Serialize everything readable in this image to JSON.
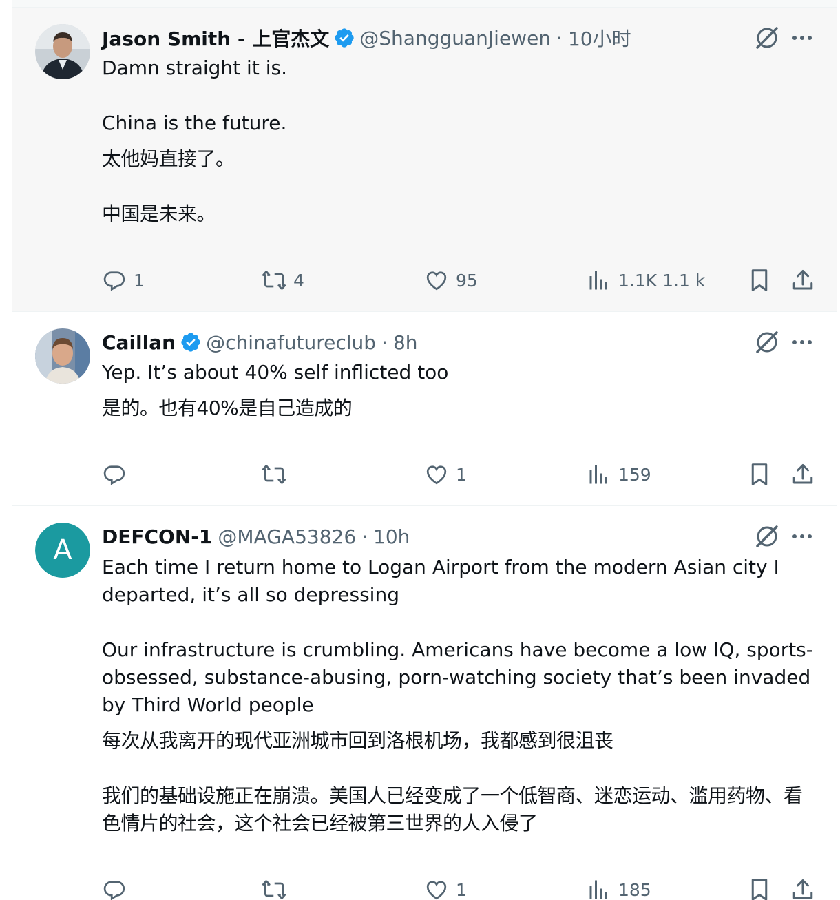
{
  "tweets": [
    {
      "name": "Jason Smith - 上官杰文",
      "handle": "@ShangguanJiewen",
      "separator": "·",
      "time": "10小时",
      "text_en": [
        "Damn straight it is.",
        "",
        "China is the future."
      ],
      "text_zh": [
        "太他妈直接了。",
        "",
        "中国是未来。"
      ],
      "replies": "1",
      "retweets": "4",
      "likes": "95",
      "views": "1.1K 1.1 k"
    },
    {
      "name": "Caillan",
      "handle": "@chinafutureclub",
      "separator": "·",
      "time": "8h",
      "text_en": [
        "Yep. It’s about 40% self inflicted too"
      ],
      "text_zh": [
        "是的。也有40%是自己造成的"
      ],
      "replies": "",
      "retweets": "",
      "likes": "1",
      "views": "159"
    },
    {
      "name": "DEFCON-1",
      "avatar_letter": "A",
      "handle": "@MAGA53826",
      "separator": "·",
      "time": "10h",
      "text_en": [
        "Each time I return home to Logan Airport from the modern Asian city I departed, it’s all so depressing",
        "",
        "Our infrastructure is crumbling. Americans have become a low IQ, sports-obsessed, substance-abusing, porn-watching society that’s been invaded by Third World people"
      ],
      "text_zh": [
        "每次从我离开的现代亚洲城市回到洛根机场，我都感到很沮丧",
        "",
        "我们的基础设施正在崩溃。美国人已经变成了一个低智商、迷恋运动、滥用药物、看色情片的社会，这个社会已经被第三世界的人入侵了"
      ],
      "replies": "",
      "retweets": "",
      "likes": "1",
      "views": "185"
    }
  ],
  "colors": {
    "text": "#0f1419",
    "secondary": "#536471",
    "verified": "#1d9bf0",
    "highlight_bg": "#f7f7f7",
    "avatar_letter_bg": "#1b9aa0"
  }
}
